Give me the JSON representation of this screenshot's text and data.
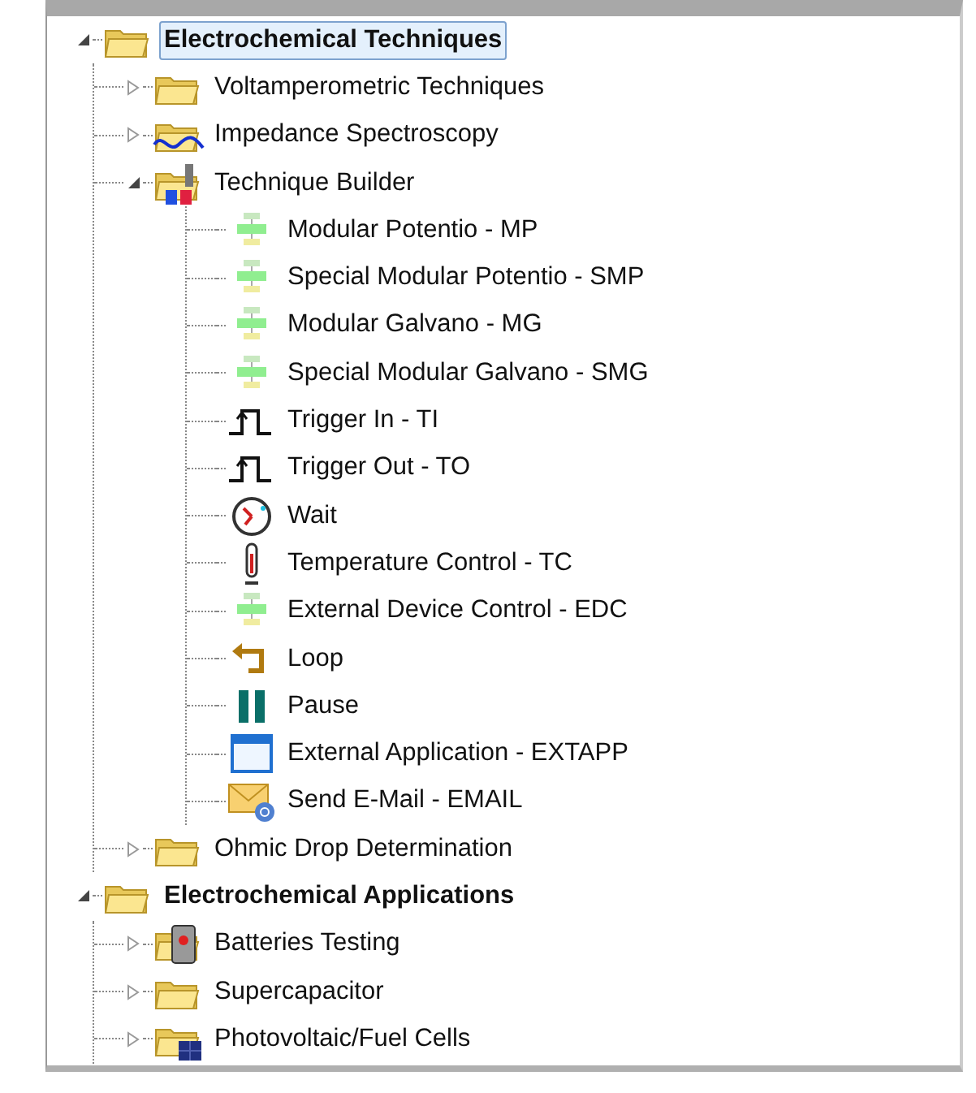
{
  "tree": {
    "items": [
      {
        "label": "Electrochemical Techniques",
        "kind": "folder",
        "expanded": true,
        "selected": true,
        "children": [
          {
            "label": "Voltamperometric Techniques",
            "kind": "folder",
            "expanded": false,
            "selected": false
          },
          {
            "label": "Impedance Spectroscopy",
            "kind": "impedance",
            "expanded": false,
            "selected": false
          },
          {
            "label": "Technique Builder",
            "kind": "builder",
            "expanded": true,
            "selected": false,
            "children": [
              {
                "label": "Modular Potentio - MP",
                "kind": "modular",
                "selected": false
              },
              {
                "label": "Special Modular Potentio - SMP",
                "kind": "modular",
                "selected": false
              },
              {
                "label": "Modular Galvano - MG",
                "kind": "modular",
                "selected": false
              },
              {
                "label": "Special Modular Galvano - SMG",
                "kind": "modular",
                "selected": false
              },
              {
                "label": "Trigger In - TI",
                "kind": "trigger",
                "selected": false
              },
              {
                "label": "Trigger Out - TO",
                "kind": "trigger",
                "selected": false
              },
              {
                "label": "Wait",
                "kind": "wait",
                "selected": false
              },
              {
                "label": "Temperature Control - TC",
                "kind": "temperature",
                "selected": false
              },
              {
                "label": "External Device Control - EDC",
                "kind": "modular",
                "selected": false
              },
              {
                "label": "Loop",
                "kind": "loop",
                "selected": false
              },
              {
                "label": "Pause",
                "kind": "pause",
                "selected": false
              },
              {
                "label": "External Application - EXTAPP",
                "kind": "application",
                "selected": false
              },
              {
                "label": "Send E-Mail - EMAIL",
                "kind": "email",
                "selected": false
              }
            ]
          },
          {
            "label": "Ohmic Drop Determination",
            "kind": "folder",
            "expanded": false,
            "selected": false
          }
        ]
      },
      {
        "label": "Electrochemical Applications",
        "kind": "folder",
        "expanded": true,
        "selected": false,
        "children": [
          {
            "label": "Batteries Testing",
            "kind": "battery",
            "expanded": false,
            "selected": false
          },
          {
            "label": "Supercapacitor",
            "kind": "folder",
            "expanded": false,
            "selected": false
          },
          {
            "label": "Photovoltaic/Fuel Cells",
            "kind": "photovoltaic",
            "expanded": false,
            "selected": false
          }
        ]
      }
    ]
  }
}
